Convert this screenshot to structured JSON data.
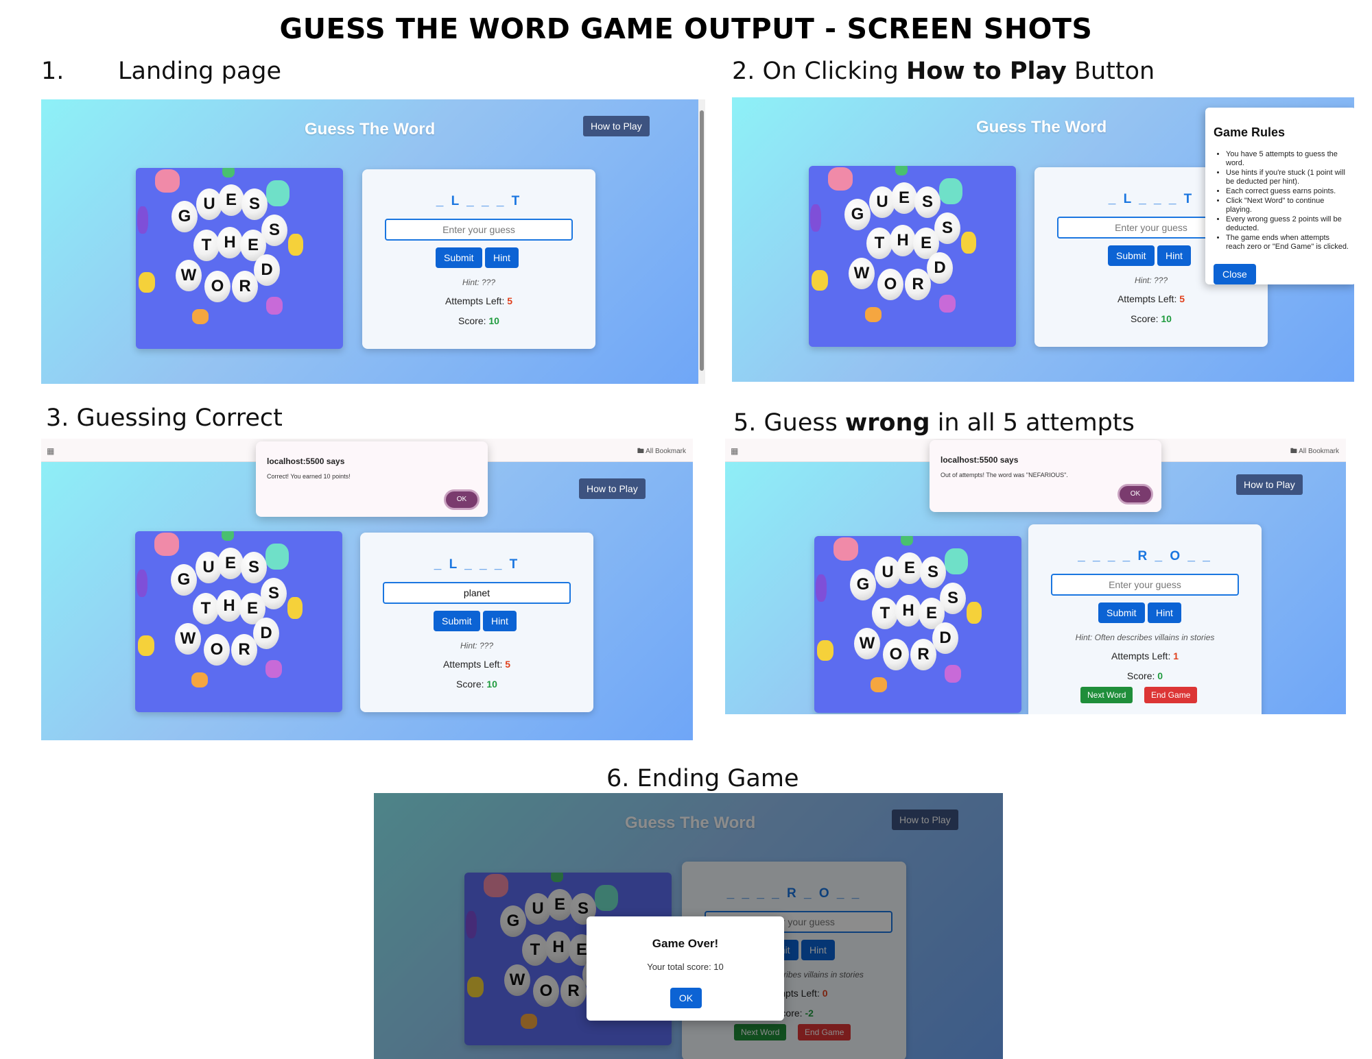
{
  "doc_title": "GUESS THE WORD GAME OUTPUT - SCREEN SHOTS",
  "sections": {
    "s1_number": "1.",
    "s1_label": "Landing page",
    "s2_pre": "2. On Clicking ",
    "s2_bold": "How to Play",
    "s2_post": " Button",
    "s3": "3. Guessing Correct",
    "s5_pre": "5. Guess ",
    "s5_bold": "wrong",
    "s5_post": " in all 5 attempts",
    "s6": "6. Ending Game"
  },
  "game": {
    "title": "Guess The Word",
    "how_to_play": "How to Play",
    "art_letters": [
      "G",
      "U",
      "E",
      "S",
      "S",
      "T",
      "H",
      "E",
      "W",
      "O",
      "R",
      "D"
    ],
    "placeholder": "Enter your guess",
    "submit": "Submit",
    "hint_button": "Hint",
    "attempts_label": "Attempts Left:",
    "score_label": "Score:",
    "next_word": "Next Word",
    "end_game": "End Game"
  },
  "shot1": {
    "word": "_ L _ _ _ T",
    "hint": "Hint: ???",
    "attempts": "5",
    "score": "10"
  },
  "shot2": {
    "word": "_ L _ _ _ T",
    "hint": "Hint: ???",
    "attempts": "5",
    "score": "10",
    "rules_title": "Game Rules",
    "rules": [
      "You have 5 attempts to guess the word.",
      "Use hints if you're stuck (1 point will be deducted per hint).",
      "Each correct guess earns points.",
      "Click \"Next Word\" to continue playing.",
      "Every wrong guess 2 points will be deducted.",
      "The game ends when attempts reach zero or \"End Game\" is clicked."
    ],
    "close": "Close"
  },
  "shot3": {
    "word": "_ L _ _ _ T",
    "input_value": "planet",
    "hint": "Hint: ???",
    "attempts": "5",
    "score": "10",
    "bookmarks": "All Bookmark",
    "alert_host": "localhost:5500 says",
    "alert_msg": "Correct! You earned 10 points!",
    "alert_ok": "OK"
  },
  "shot5": {
    "word": "_ _ _ _ R _ O _ _",
    "hint": "Hint: Often describes villains in stories",
    "attempts": "1",
    "score": "0",
    "bookmarks": "All Bookmark",
    "alert_host": "localhost:5500 says",
    "alert_msg": "Out of attempts! The word was \"NEFARIOUS\".",
    "alert_ok": "OK"
  },
  "shot6": {
    "word": "_ _ _ _ R _ O _ _",
    "hint": "Hint: Often describes villains in stories",
    "attempts": "0",
    "score": "-2",
    "modal_title": "Game Over!",
    "modal_msg": "Your total score: 10",
    "modal_ok": "OK"
  },
  "colors": {
    "accent": "#0c63d4",
    "attempts": "#e0401c",
    "score": "#1f9b3e",
    "next": "#1f8e3a",
    "end": "#dc3535"
  }
}
